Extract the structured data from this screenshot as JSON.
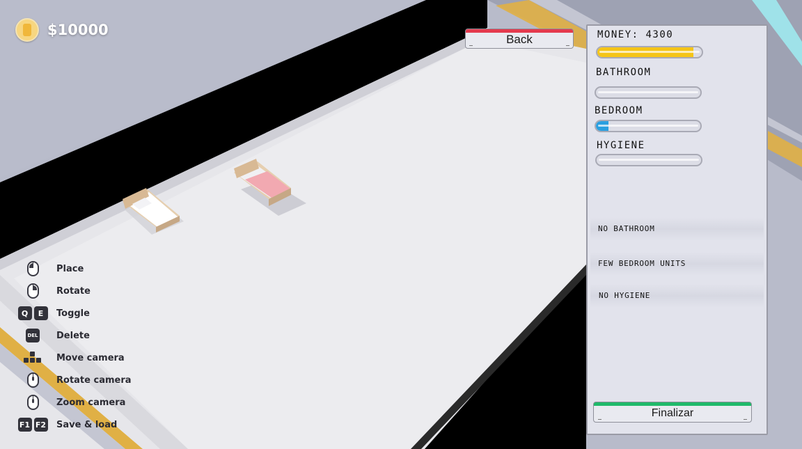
{
  "hud": {
    "money": "$10000"
  },
  "buttons": {
    "back": "Back",
    "finalize": "Finalizar"
  },
  "controls": [
    {
      "label": "Place",
      "icon": "mouse-left-icon"
    },
    {
      "label": "Rotate",
      "icon": "mouse-right-icon"
    },
    {
      "label": "Toggle",
      "keys": [
        "Q",
        "E"
      ],
      "icon": "keyboard-q-e-icon"
    },
    {
      "label": "Delete",
      "keys": [
        "DEL"
      ],
      "icon": "keyboard-del-icon"
    },
    {
      "label": "Move camera",
      "icon": "arrow-keys-icon"
    },
    {
      "label": "Rotate camera",
      "icon": "mouse-middle-icon"
    },
    {
      "label": "Zoom camera",
      "icon": "mouse-scroll-icon"
    },
    {
      "label": "Save & load",
      "keys": [
        "F1",
        "F2"
      ],
      "icon": "keyboard-f1-f2-icon"
    }
  ],
  "panel": {
    "money_label": "MONEY: 4300",
    "money_level": 0.92,
    "stats": [
      {
        "label": "BATHROOM",
        "level": 0.0
      },
      {
        "label": "BEDROOM",
        "level": 0.12
      },
      {
        "label": "HYGIENE",
        "level": 0.0
      }
    ],
    "warnings": [
      "NO BATHROOM",
      "FEW BEDROOM UNITS",
      "NO HYGIENE"
    ]
  },
  "colors": {
    "money_bar": "#f5c518",
    "bedroom_bar": "#2a9fe0",
    "back_accent": "#e43a4e",
    "finalize_accent": "#1fba6a"
  }
}
